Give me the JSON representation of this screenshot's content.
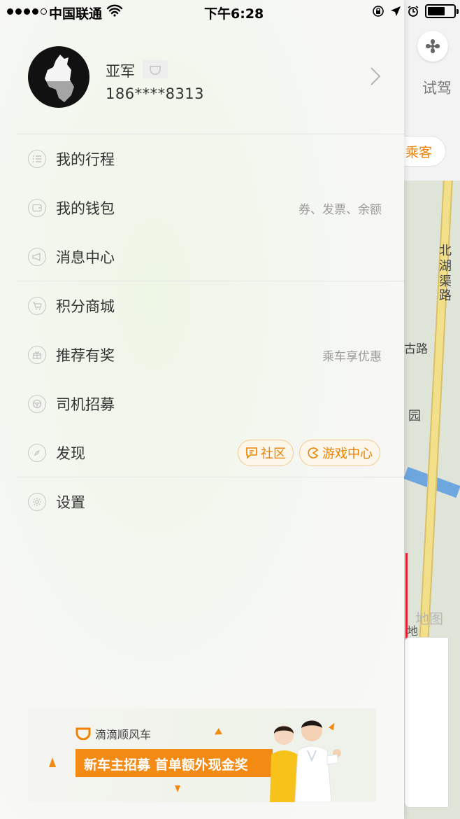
{
  "status_bar": {
    "carrier": "中国联通",
    "time": "下午6:28"
  },
  "map_behind": {
    "test_label": "试驾",
    "passenger_button": "乘客",
    "road_labels": [
      "北",
      "湖",
      "渠",
      "路"
    ],
    "road_label_2": "古路",
    "park_label": "园",
    "watermark": "地图",
    "road_ground": "地"
  },
  "profile": {
    "name": "亚军",
    "phone": "186****8313"
  },
  "menu": {
    "trips": {
      "label": "我的行程"
    },
    "wallet": {
      "label": "我的钱包",
      "hint": "券、发票、余额"
    },
    "messages": {
      "label": "消息中心"
    },
    "points_mall": {
      "label": "积分商城"
    },
    "referral": {
      "label": "推荐有奖",
      "hint": "乘车享优惠"
    },
    "driver_recruit": {
      "label": "司机招募"
    },
    "discover": {
      "label": "发现",
      "community": "社区",
      "game_center": "游戏中心"
    },
    "settings": {
      "label": "设置"
    }
  },
  "banner": {
    "brand": "滴滴顺风车",
    "headline": "新车主招募 首单额外现金奖"
  },
  "colors": {
    "accent": "#f08200",
    "banner_orange": "#f38a14"
  }
}
